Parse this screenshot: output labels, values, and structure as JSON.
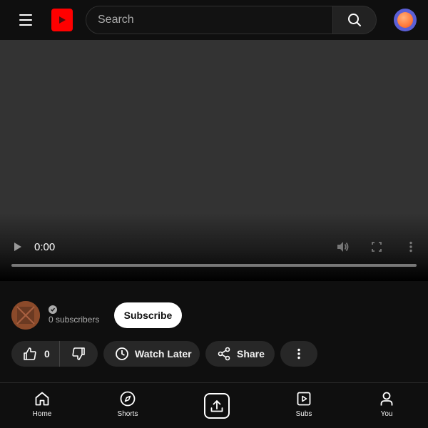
{
  "topbar": {
    "search_placeholder": "Search",
    "icons": {
      "menu": "hamburger-menu-icon",
      "logo": "play-logo-icon",
      "search": "search-icon",
      "avatar": "user-avatar"
    },
    "brand_color": "#ff0000"
  },
  "player": {
    "time": "0:00",
    "progress": 0,
    "icons": {
      "play": "play-icon",
      "volume": "volume-icon",
      "fullscreen": "fullscreen-icon",
      "more": "more-vert-icon"
    }
  },
  "channel": {
    "subscribers": "0 subscribers",
    "subscribe_label": "Subscribe"
  },
  "actions": {
    "like_count": "0",
    "watch_later_label": "Watch Later",
    "share_label": "Share"
  },
  "bottom_nav": {
    "items": [
      {
        "label": "Home",
        "icon": "home-icon"
      },
      {
        "label": "Shorts",
        "icon": "compass-icon"
      },
      {
        "label": "",
        "icon": "upload-icon"
      },
      {
        "label": "Subs",
        "icon": "subscriptions-icon"
      },
      {
        "label": "You",
        "icon": "person-icon"
      }
    ]
  }
}
